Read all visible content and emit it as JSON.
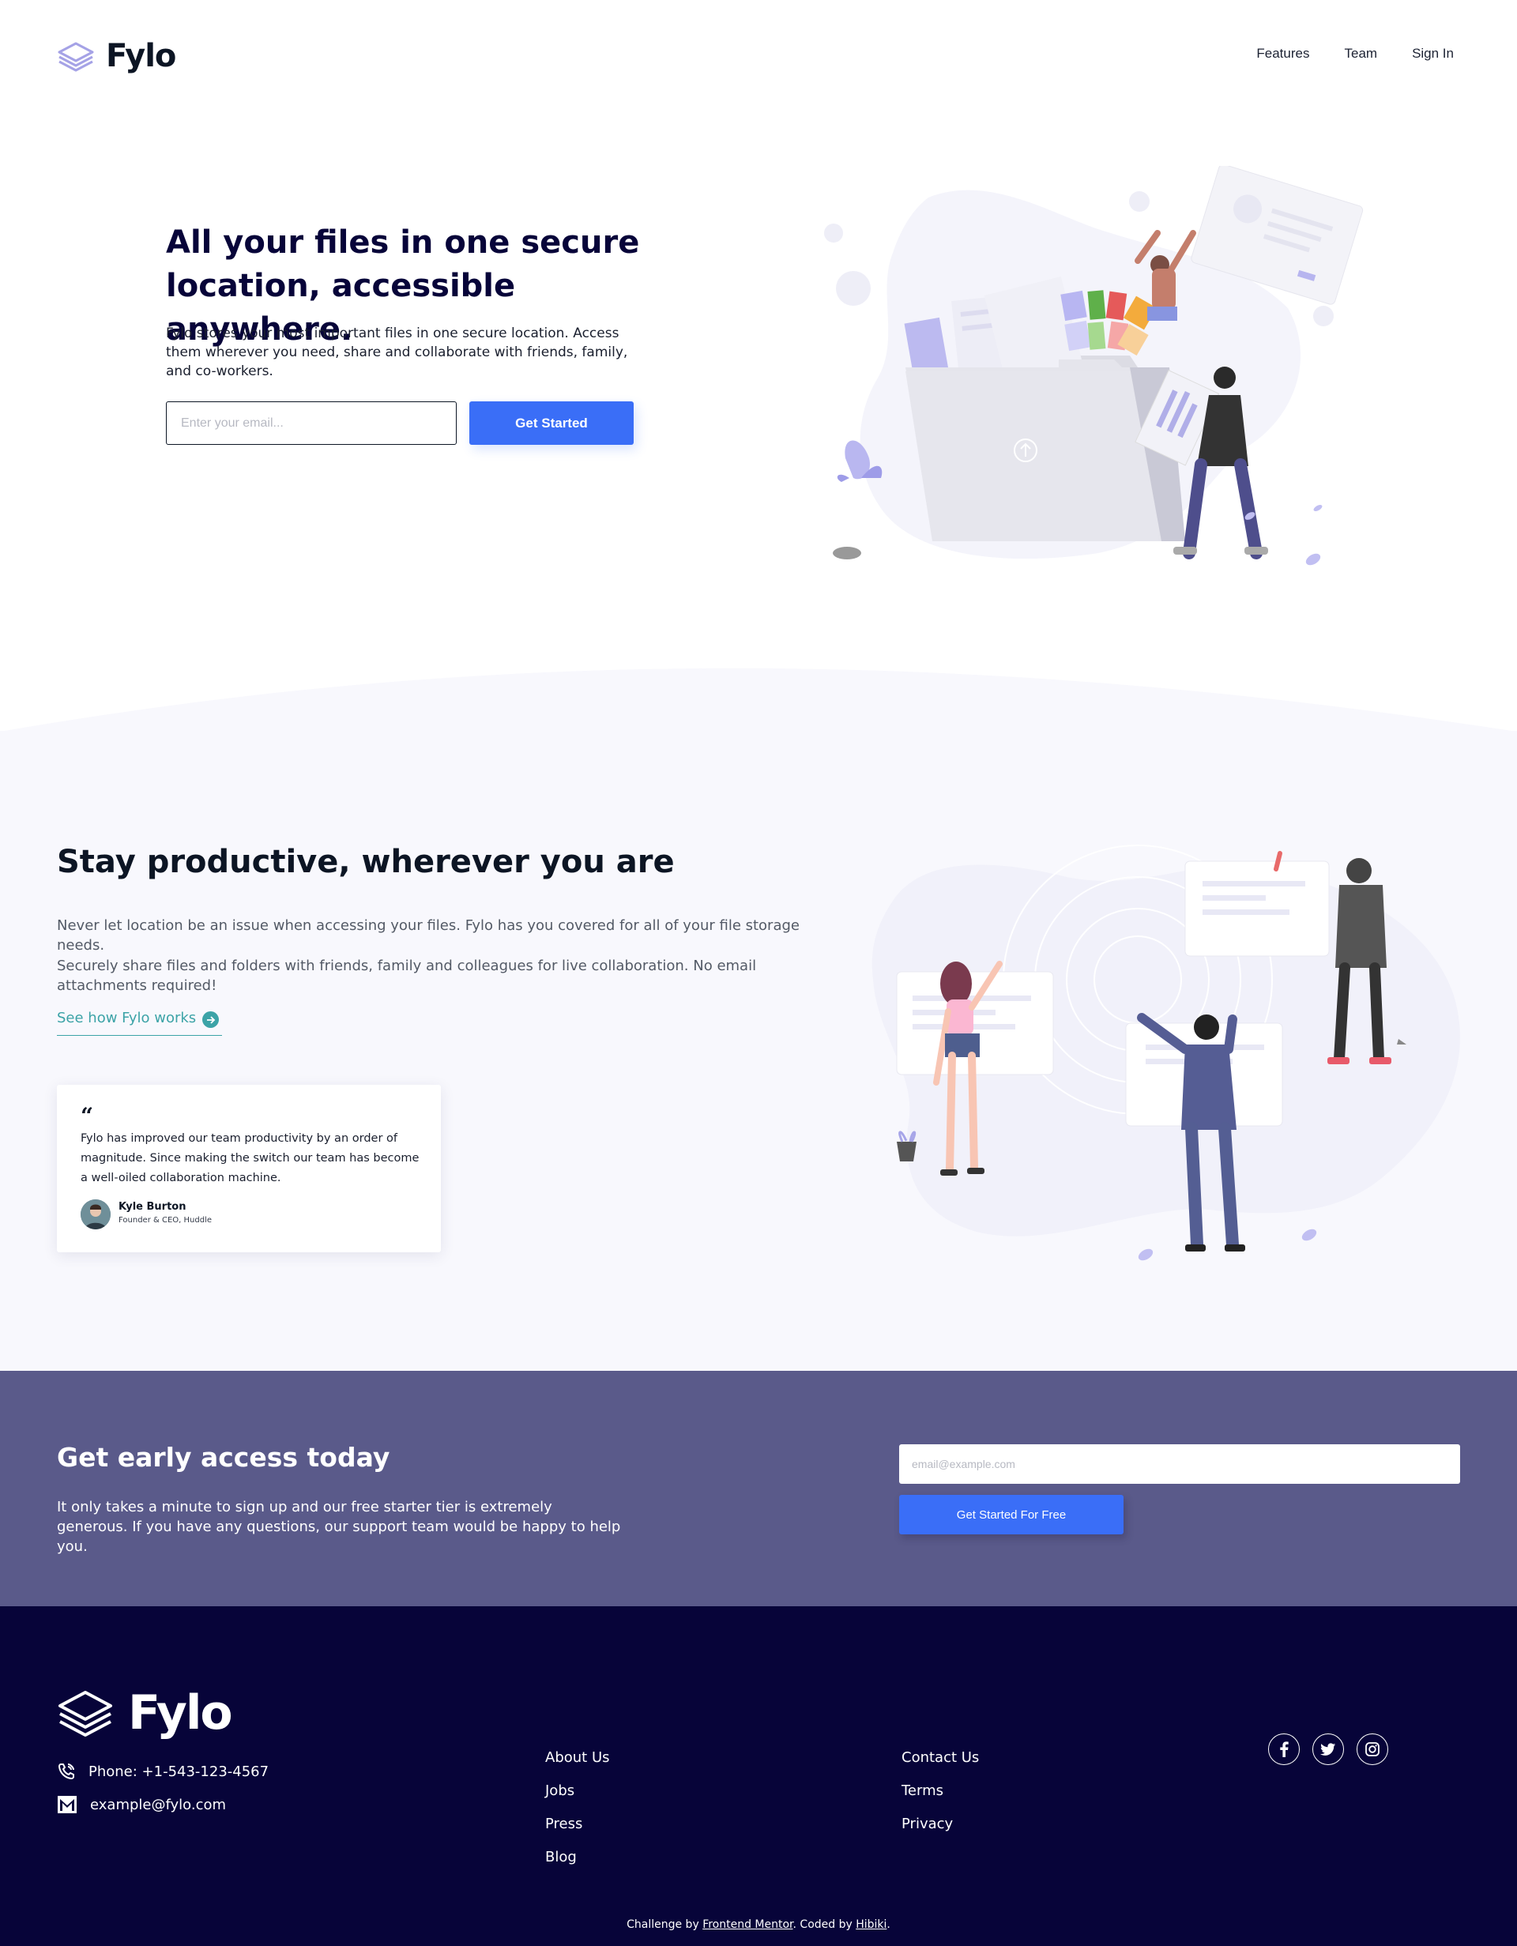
{
  "header": {
    "logo_text": "Fylo",
    "nav": [
      "Features",
      "Team",
      "Sign In"
    ]
  },
  "hero": {
    "title": "All your files in one secure location, accessible anywhere.",
    "description": "Fylo stores your most important files in one secure location. Access them wherever you need, share and collaborate with friends, family, and co-workers.",
    "email_placeholder": "Enter your email...",
    "cta_label": "Get Started"
  },
  "productive": {
    "title": "Stay productive, wherever you are",
    "paragraph_1": "Never let location be an issue when accessing your files. Fylo has you covered for all of your file storage needs.",
    "paragraph_2": "Securely share files and folders with friends, family and colleagues for live collaboration. No email attachments required!",
    "link_label": "See how Fylo works",
    "testimonial": {
      "quote_mark": "“",
      "text": "Fylo has improved our team productivity by an order of magnitude. Since making the switch our team has become a well-oiled collaboration machine.",
      "name": "Kyle Burton",
      "role": "Founder & CEO, Huddle"
    }
  },
  "early_access": {
    "title": "Get early access today",
    "description": "It only takes a minute to sign up and our free starter tier is extremely generous. If you have any questions, our support team would be happy to help you.",
    "email_placeholder": "email@example.com",
    "cta_label": "Get Started For Free"
  },
  "footer": {
    "logo_text": "Fylo",
    "phone": "Phone: +1-543-123-4567",
    "email": "example@fylo.com",
    "links_col_1": [
      "About Us",
      "Jobs",
      "Press",
      "Blog"
    ],
    "links_col_2": [
      "Contact Us",
      "Terms",
      "Privacy"
    ],
    "social_icons": [
      "facebook-icon",
      "twitter-icon",
      "instagram-icon"
    ],
    "credit_prefix": "Challenge by",
    "credit_link_1": "Frontend Mentor",
    "credit_middle": ". Coded by",
    "credit_link_2": "Hibiki",
    "credit_suffix": "."
  },
  "colors": {
    "accent_blue": "#3a6ef7",
    "teal": "#3ca3a7",
    "navy": "#070439",
    "early_access_bg": "#5a5a8a",
    "section_bg": "#f8f8fd"
  }
}
